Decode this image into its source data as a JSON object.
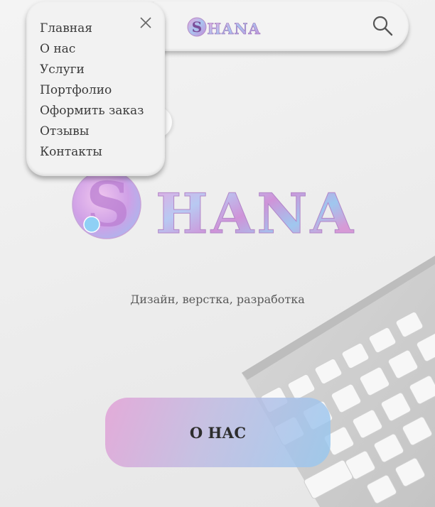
{
  "header": {
    "logo_text": "SHANA",
    "search_icon": "search-icon"
  },
  "menu": {
    "close_icon": "close-icon",
    "items": [
      {
        "label": "Главная"
      },
      {
        "label": "О нас"
      },
      {
        "label": "Услуги"
      },
      {
        "label": "Портфолио"
      },
      {
        "label": "Оформить заказ"
      },
      {
        "label": "Отзывы"
      },
      {
        "label": "Контакты"
      }
    ]
  },
  "hero": {
    "logo_text": "SHANA",
    "tagline": "Дизайн, верстка, разработка",
    "button_label": "О НАС"
  },
  "colors": {
    "pink": "#e2a0d6",
    "lavender": "#bcb9e1",
    "sky": "#96c8f0",
    "text": "#3a3a3a"
  }
}
